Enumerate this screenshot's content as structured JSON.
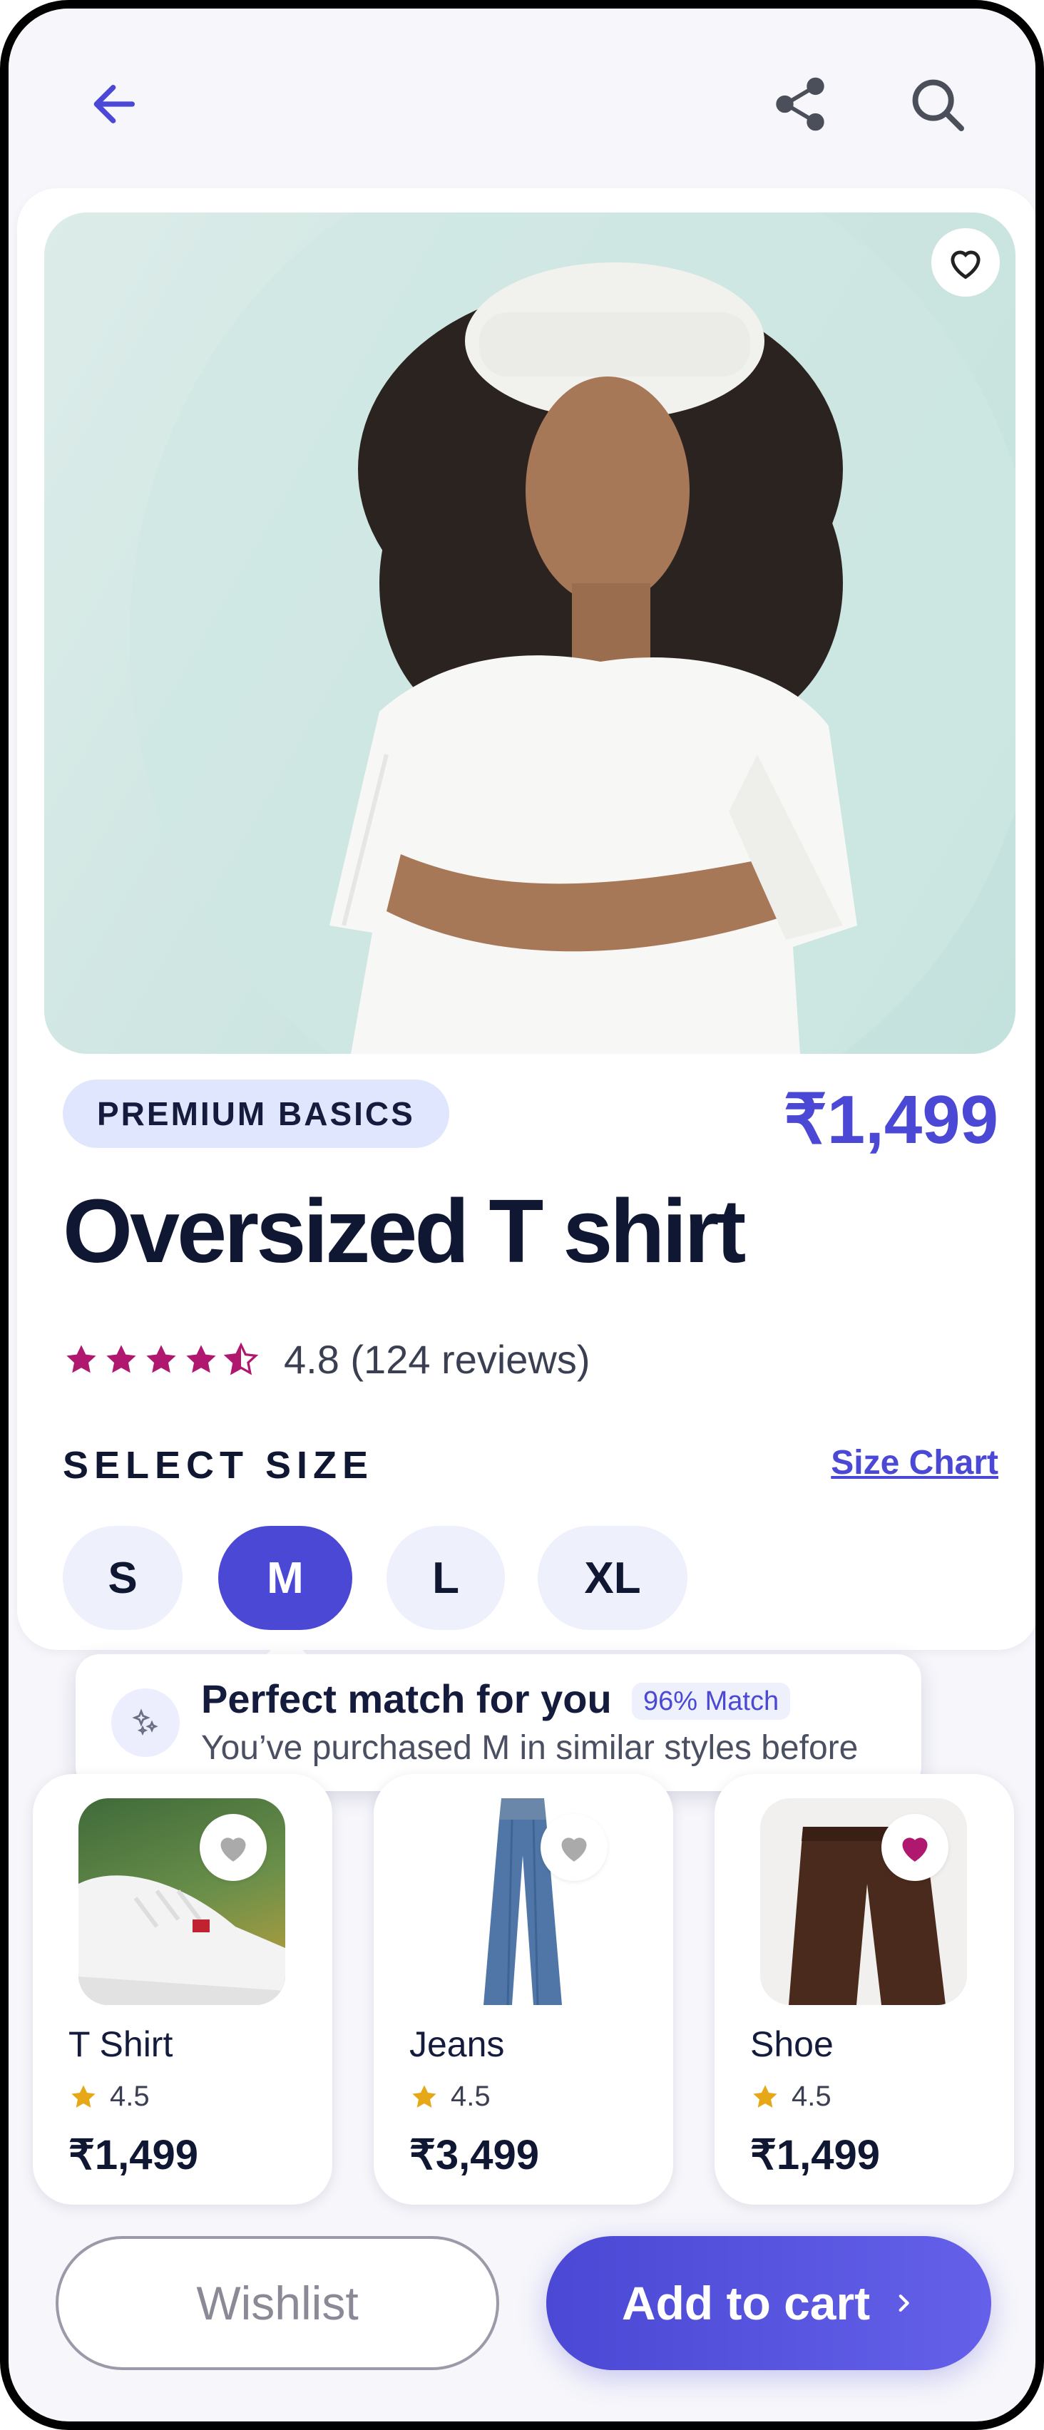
{
  "header": {
    "back_icon": "arrow-left-icon",
    "share_icon": "share-icon",
    "search_icon": "search-icon"
  },
  "product": {
    "badge": "PREMIUM BASICS",
    "price": "₹1,499",
    "title": "Oversized T shirt",
    "rating_value": 4.5,
    "rating_text": "4.8 (124 reviews)"
  },
  "size": {
    "label": "SELECT SIZE",
    "chart_link": "Size Chart",
    "options": [
      "S",
      "M",
      "L",
      "XL"
    ],
    "selected": "M"
  },
  "tooltip": {
    "title": "Perfect match for you",
    "match": "96% Match",
    "subtitle": "You’ve purchased M in similar styles before"
  },
  "recommendations": [
    {
      "name": "T Shirt",
      "rating": "4.5",
      "price": "₹1,499",
      "favorited": false
    },
    {
      "name": "Jeans",
      "rating": "4.5",
      "price": "₹3,499",
      "favorited": false
    },
    {
      "name": "Shoe",
      "rating": "4.5",
      "price": "₹1,499",
      "favorited": true
    }
  ],
  "actions": {
    "wishlist": "Wishlist",
    "add_to_cart": "Add to cart"
  },
  "colors": {
    "accent": "#4a48d4",
    "star": "#b0176e",
    "heart_active": "#b0176e",
    "rec_star": "#e6a817"
  }
}
